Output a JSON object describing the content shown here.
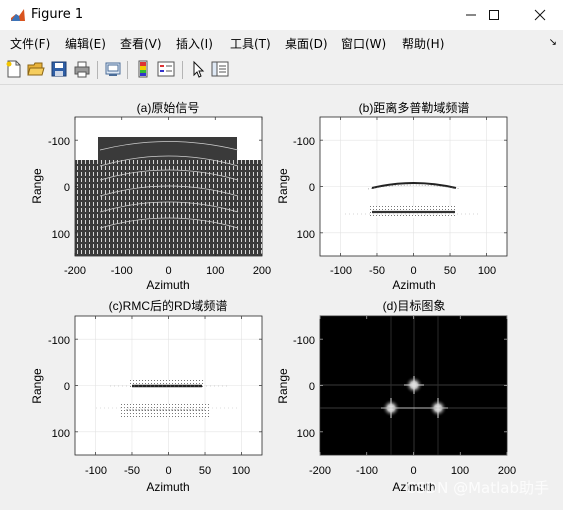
{
  "window": {
    "title": "Figure 1",
    "controls": {
      "minimize": "─",
      "maximize": "☐",
      "close": "✕"
    }
  },
  "menu": {
    "items": [
      "文件(F)",
      "编辑(E)",
      "查看(V)",
      "插入(I)",
      "工具(T)",
      "桌面(D)",
      "窗口(W)",
      "帮助(H)"
    ],
    "corner": "↘"
  },
  "toolbar": {
    "buttons": [
      "new-figure-icon",
      "open-folder-icon",
      "save-icon",
      "print-icon",
      "link-plot-icon",
      "insert-colorbar-icon",
      "insert-legend-icon",
      "pointer-icon",
      "property-inspector-icon"
    ]
  },
  "plots": [
    {
      "title": "(a)原始信号",
      "xlabel": "Azimuth",
      "ylabel": "Range",
      "xticks": [
        "-200",
        "-100",
        "0",
        "100",
        "200"
      ],
      "yticks": [
        "-100",
        "0",
        "100"
      ],
      "xlim": [
        -200,
        200
      ],
      "ylim": [
        -150,
        150
      ]
    },
    {
      "title": "(b)距离多普勒域频谱",
      "xlabel": "Azimuth",
      "ylabel": "Range",
      "xticks": [
        "-100",
        "-50",
        "0",
        "50",
        "100"
      ],
      "yticks": [
        "-100",
        "0",
        "100"
      ],
      "xlim": [
        -128,
        128
      ],
      "ylim": [
        -150,
        150
      ]
    },
    {
      "title": "(c)RMC后的RD域频谱",
      "xlabel": "Azimuth",
      "ylabel": "Range",
      "xticks": [
        "-100",
        "-50",
        "0",
        "50",
        "100"
      ],
      "yticks": [
        "-100",
        "0",
        "100"
      ],
      "xlim": [
        -128,
        128
      ],
      "ylim": [
        -150,
        150
      ]
    },
    {
      "title": "(d)目标图象",
      "xlabel": "Azimuth",
      "ylabel": "Range",
      "xticks": [
        "-200",
        "-100",
        "0",
        "100",
        "200"
      ],
      "yticks": [
        "-100",
        "0",
        "100"
      ],
      "xlim": [
        -200,
        200
      ],
      "ylim": [
        -150,
        150
      ]
    }
  ],
  "watermark": "CSDN @Matlab助手",
  "colors": {
    "axes_bg_light": "#ffffff",
    "axes_bg_dark": "#000000",
    "signal": "#3a3a3a",
    "window_bg": "#f0f0f0"
  }
}
